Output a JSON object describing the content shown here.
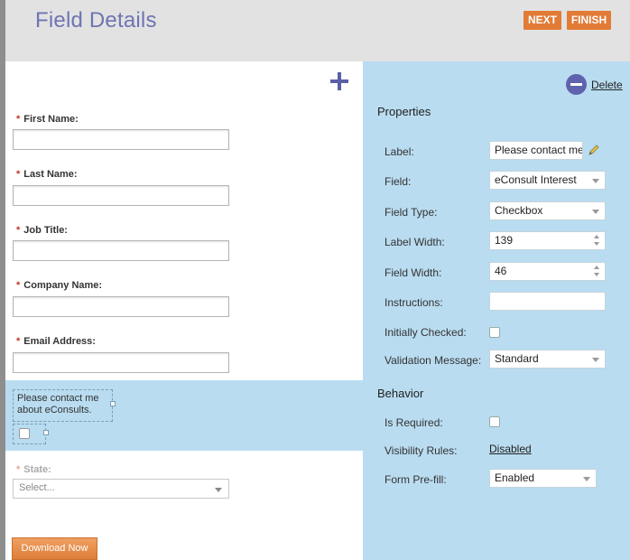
{
  "header": {
    "title": "Field Details",
    "next_label": "NEXT",
    "finish_label": "FINISH"
  },
  "form": {
    "fields": [
      {
        "label": "First Name:",
        "required_mark": "*"
      },
      {
        "label": "Last Name:",
        "required_mark": "*"
      },
      {
        "label": "Job Title:",
        "required_mark": "*"
      },
      {
        "label": "Company Name:",
        "required_mark": "*"
      },
      {
        "label": "Email Address:",
        "required_mark": "*"
      }
    ],
    "selected_field": {
      "label_line1": "Please contact me",
      "label_line2": "about eConsults."
    },
    "state": {
      "label": "State:",
      "required_mark": "*",
      "placeholder": "Select..."
    },
    "download_label": "Download Now"
  },
  "panel": {
    "delete_label": "Delete",
    "properties_title": "Properties",
    "behavior_title": "Behavior",
    "properties": {
      "label": {
        "name": "Label:",
        "value": "Please contact me"
      },
      "field": {
        "name": "Field:",
        "value": "eConsult Interest"
      },
      "field_type": {
        "name": "Field Type:",
        "value": "Checkbox"
      },
      "label_width": {
        "name": "Label Width:",
        "value": "139"
      },
      "field_width": {
        "name": "Field Width:",
        "value": "46"
      },
      "instructions": {
        "name": "Instructions:",
        "value": ""
      },
      "initially_checked": {
        "name": "Initially Checked:",
        "checked": false
      },
      "validation_message": {
        "name": "Validation Message:",
        "value": "Standard"
      }
    },
    "behavior": {
      "is_required": {
        "name": "Is Required:",
        "checked": false
      },
      "visibility_rules": {
        "name": "Visibility Rules:",
        "value": "Disabled"
      },
      "form_prefill": {
        "name": "Form Pre-fill:",
        "value": "Enabled"
      }
    }
  },
  "colors": {
    "accent_orange": "#e27b36",
    "title_purple": "#6e74b3",
    "panel_blue": "#b9dcf0",
    "required_red": "#c0392b"
  },
  "icons": [
    "plus-icon",
    "minus-circle-icon",
    "pencil-icon",
    "chevron-down-icon",
    "spinner-icon"
  ]
}
